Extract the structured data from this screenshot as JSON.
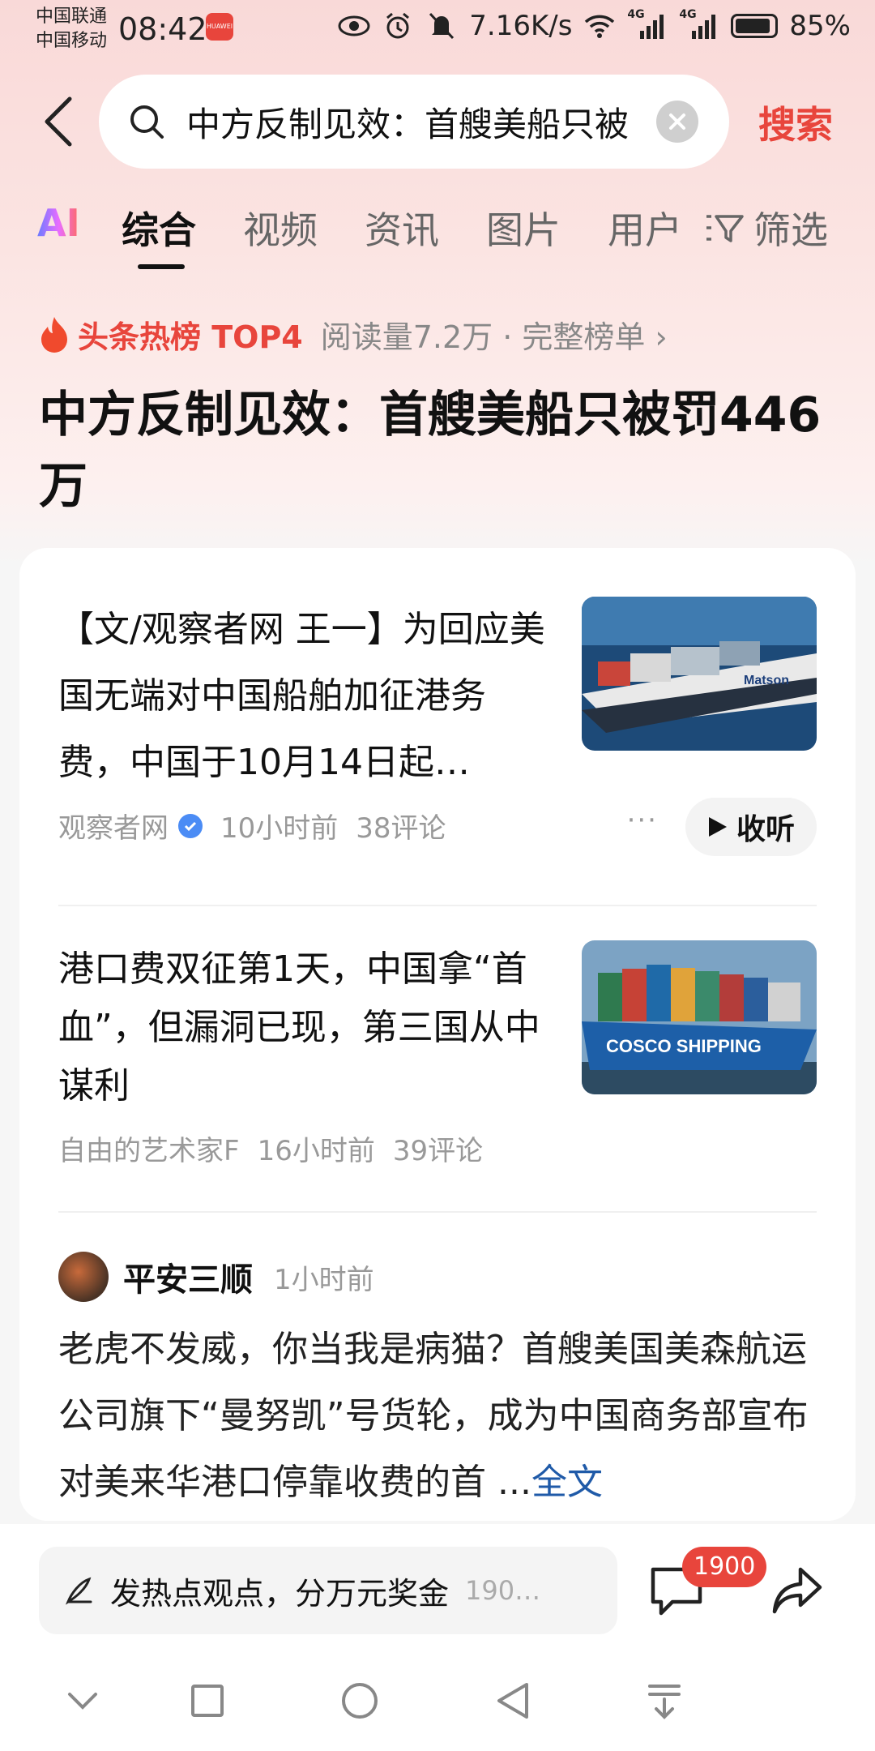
{
  "status_bar": {
    "carrier1": "中国联通",
    "carrier2": "中国移动",
    "time": "08:42",
    "app_badge": "HUAWEI",
    "net_speed": "7.16K/s",
    "net1": "4G",
    "net2": "4G",
    "battery": "85%"
  },
  "search": {
    "query": "中方反制见效：首艘美船只被",
    "submit_label": "搜索"
  },
  "tabs": [
    {
      "label": "AI"
    },
    {
      "label": "综合"
    },
    {
      "label": "视频"
    },
    {
      "label": "资讯"
    },
    {
      "label": "图片"
    },
    {
      "label": "用户"
    },
    {
      "label": "筛选"
    }
  ],
  "hot": {
    "label": "头条热榜 TOP4",
    "reads": "阅读量7.2万 · 完整榜单 ›"
  },
  "headline": "中方反制见效：首艘美船只被罚446万",
  "articles": [
    {
      "title": "【文/观察者网 王一】为回应美国无端对中国船舶加征港务费，中国于10月14日起…",
      "source": "观察者网",
      "time": "10小时前",
      "comments": "38评论",
      "more": "···",
      "listen": "收听",
      "thumb_text": "Matson"
    },
    {
      "title": "港口费双征第1天，中国拿“首血”，但漏洞已现，第三国从中谋利",
      "source": "自由的艺术家F",
      "time": "16小时前",
      "comments": "39评论",
      "thumb_text": "COSCO SHIPPING"
    }
  ],
  "post": {
    "username": "平安三顺",
    "time": "1小时前",
    "body": "老虎不发威，你当我是病猫？首艘美国美森航运公司旗下“曼努凯”号货轮，成为中国商务部宣布对美来华港口停靠收费的首 ...",
    "more_link": "全文"
  },
  "action_bar": {
    "placeholder": "发热点观点，分万元奖金",
    "extra": "190…",
    "comment_count": "1900"
  },
  "colors": {
    "accent": "#e8453c",
    "link": "#1f5aa8"
  }
}
